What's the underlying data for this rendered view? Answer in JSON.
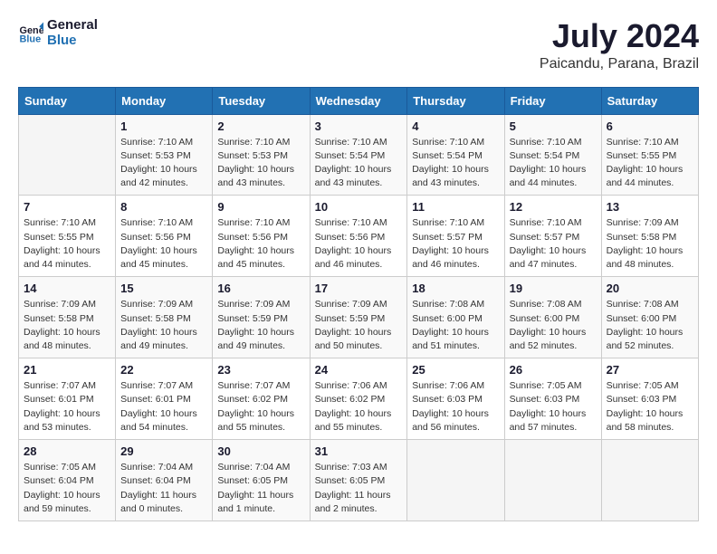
{
  "logo": {
    "text1": "General",
    "text2": "Blue"
  },
  "title": {
    "month_year": "July 2024",
    "location": "Paicandu, Parana, Brazil"
  },
  "header_days": [
    "Sunday",
    "Monday",
    "Tuesday",
    "Wednesday",
    "Thursday",
    "Friday",
    "Saturday"
  ],
  "weeks": [
    [
      {
        "day": "",
        "info": ""
      },
      {
        "day": "1",
        "info": "Sunrise: 7:10 AM\nSunset: 5:53 PM\nDaylight: 10 hours\nand 42 minutes."
      },
      {
        "day": "2",
        "info": "Sunrise: 7:10 AM\nSunset: 5:53 PM\nDaylight: 10 hours\nand 43 minutes."
      },
      {
        "day": "3",
        "info": "Sunrise: 7:10 AM\nSunset: 5:54 PM\nDaylight: 10 hours\nand 43 minutes."
      },
      {
        "day": "4",
        "info": "Sunrise: 7:10 AM\nSunset: 5:54 PM\nDaylight: 10 hours\nand 43 minutes."
      },
      {
        "day": "5",
        "info": "Sunrise: 7:10 AM\nSunset: 5:54 PM\nDaylight: 10 hours\nand 44 minutes."
      },
      {
        "day": "6",
        "info": "Sunrise: 7:10 AM\nSunset: 5:55 PM\nDaylight: 10 hours\nand 44 minutes."
      }
    ],
    [
      {
        "day": "7",
        "info": "Sunrise: 7:10 AM\nSunset: 5:55 PM\nDaylight: 10 hours\nand 44 minutes."
      },
      {
        "day": "8",
        "info": "Sunrise: 7:10 AM\nSunset: 5:56 PM\nDaylight: 10 hours\nand 45 minutes."
      },
      {
        "day": "9",
        "info": "Sunrise: 7:10 AM\nSunset: 5:56 PM\nDaylight: 10 hours\nand 45 minutes."
      },
      {
        "day": "10",
        "info": "Sunrise: 7:10 AM\nSunset: 5:56 PM\nDaylight: 10 hours\nand 46 minutes."
      },
      {
        "day": "11",
        "info": "Sunrise: 7:10 AM\nSunset: 5:57 PM\nDaylight: 10 hours\nand 46 minutes."
      },
      {
        "day": "12",
        "info": "Sunrise: 7:10 AM\nSunset: 5:57 PM\nDaylight: 10 hours\nand 47 minutes."
      },
      {
        "day": "13",
        "info": "Sunrise: 7:09 AM\nSunset: 5:58 PM\nDaylight: 10 hours\nand 48 minutes."
      }
    ],
    [
      {
        "day": "14",
        "info": "Sunrise: 7:09 AM\nSunset: 5:58 PM\nDaylight: 10 hours\nand 48 minutes."
      },
      {
        "day": "15",
        "info": "Sunrise: 7:09 AM\nSunset: 5:58 PM\nDaylight: 10 hours\nand 49 minutes."
      },
      {
        "day": "16",
        "info": "Sunrise: 7:09 AM\nSunset: 5:59 PM\nDaylight: 10 hours\nand 49 minutes."
      },
      {
        "day": "17",
        "info": "Sunrise: 7:09 AM\nSunset: 5:59 PM\nDaylight: 10 hours\nand 50 minutes."
      },
      {
        "day": "18",
        "info": "Sunrise: 7:08 AM\nSunset: 6:00 PM\nDaylight: 10 hours\nand 51 minutes."
      },
      {
        "day": "19",
        "info": "Sunrise: 7:08 AM\nSunset: 6:00 PM\nDaylight: 10 hours\nand 52 minutes."
      },
      {
        "day": "20",
        "info": "Sunrise: 7:08 AM\nSunset: 6:00 PM\nDaylight: 10 hours\nand 52 minutes."
      }
    ],
    [
      {
        "day": "21",
        "info": "Sunrise: 7:07 AM\nSunset: 6:01 PM\nDaylight: 10 hours\nand 53 minutes."
      },
      {
        "day": "22",
        "info": "Sunrise: 7:07 AM\nSunset: 6:01 PM\nDaylight: 10 hours\nand 54 minutes."
      },
      {
        "day": "23",
        "info": "Sunrise: 7:07 AM\nSunset: 6:02 PM\nDaylight: 10 hours\nand 55 minutes."
      },
      {
        "day": "24",
        "info": "Sunrise: 7:06 AM\nSunset: 6:02 PM\nDaylight: 10 hours\nand 55 minutes."
      },
      {
        "day": "25",
        "info": "Sunrise: 7:06 AM\nSunset: 6:03 PM\nDaylight: 10 hours\nand 56 minutes."
      },
      {
        "day": "26",
        "info": "Sunrise: 7:05 AM\nSunset: 6:03 PM\nDaylight: 10 hours\nand 57 minutes."
      },
      {
        "day": "27",
        "info": "Sunrise: 7:05 AM\nSunset: 6:03 PM\nDaylight: 10 hours\nand 58 minutes."
      }
    ],
    [
      {
        "day": "28",
        "info": "Sunrise: 7:05 AM\nSunset: 6:04 PM\nDaylight: 10 hours\nand 59 minutes."
      },
      {
        "day": "29",
        "info": "Sunrise: 7:04 AM\nSunset: 6:04 PM\nDaylight: 11 hours\nand 0 minutes."
      },
      {
        "day": "30",
        "info": "Sunrise: 7:04 AM\nSunset: 6:05 PM\nDaylight: 11 hours\nand 1 minute."
      },
      {
        "day": "31",
        "info": "Sunrise: 7:03 AM\nSunset: 6:05 PM\nDaylight: 11 hours\nand 2 minutes."
      },
      {
        "day": "",
        "info": ""
      },
      {
        "day": "",
        "info": ""
      },
      {
        "day": "",
        "info": ""
      }
    ]
  ]
}
